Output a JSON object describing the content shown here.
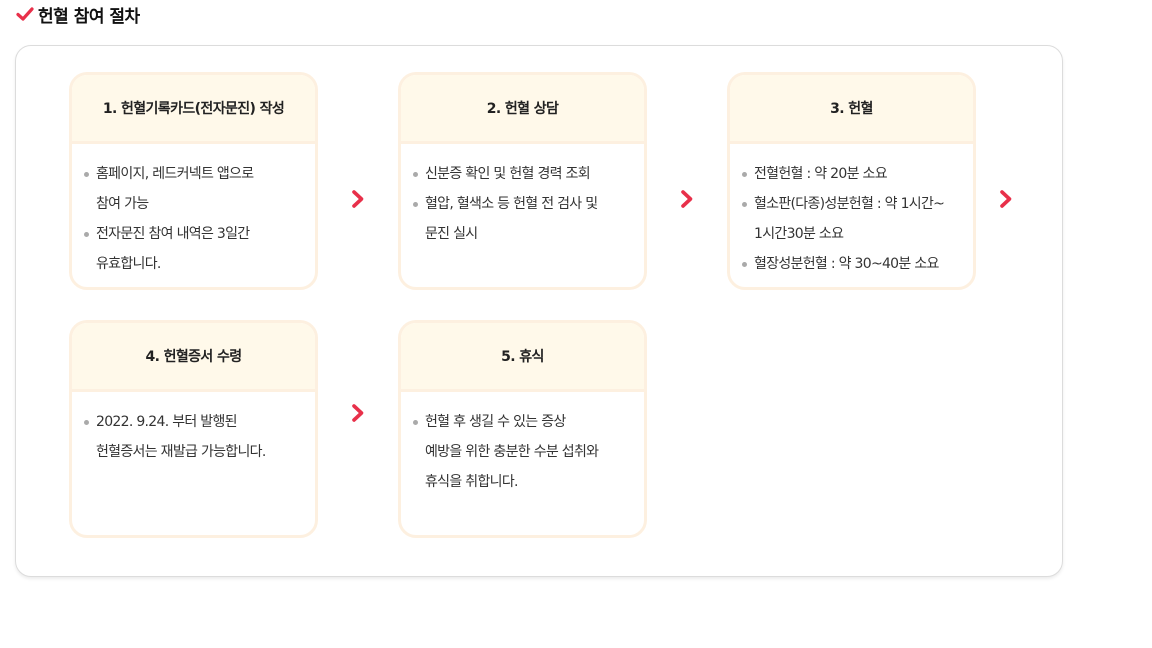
{
  "title": "헌혈 참여 절차",
  "colors": {
    "accent": "#e8304a",
    "card_border": "#fdf0e0",
    "card_header_bg": "#fff9ea",
    "bullet": "#aaaaaa"
  },
  "steps": [
    {
      "title": "1. 헌혈기록카드(전자문진) 작성",
      "items": [
        {
          "lines": [
            "홈페이지, 레드커넥트 앱으로",
            "참여 가능"
          ]
        },
        {
          "lines": [
            "전자문진 참여 내역은 3일간",
            "유효합니다."
          ]
        }
      ]
    },
    {
      "title": "2. 헌혈 상담",
      "items": [
        {
          "lines": [
            "신분증 확인 및 헌혈 경력 조회"
          ]
        },
        {
          "lines": [
            "혈압, 혈색소 등 헌혈 전 검사 및",
            "문진 실시"
          ]
        }
      ]
    },
    {
      "title": "3. 헌혈",
      "items": [
        {
          "lines": [
            "전혈헌혈 : 약 20분 소요"
          ]
        },
        {
          "lines": [
            "혈소판(다종)성분헌혈 : 약 1시간~",
            "1시간30분 소요"
          ]
        },
        {
          "lines": [
            "혈장성분헌혈 : 약 30~40분 소요"
          ]
        }
      ]
    },
    {
      "title": "4. 헌혈증서 수령",
      "items": [
        {
          "lines": [
            "2022. 9.24. 부터 발행된",
            "헌혈증서는 재발급 가능합니다."
          ]
        }
      ]
    },
    {
      "title": "5. 휴식",
      "items": [
        {
          "lines": [
            "헌혈 후 생길 수 있는 증상",
            "예방을 위한 충분한 수분 섭취와",
            "휴식을 취합니다."
          ]
        }
      ]
    }
  ],
  "arrow_icon": "chevron-right-icon"
}
